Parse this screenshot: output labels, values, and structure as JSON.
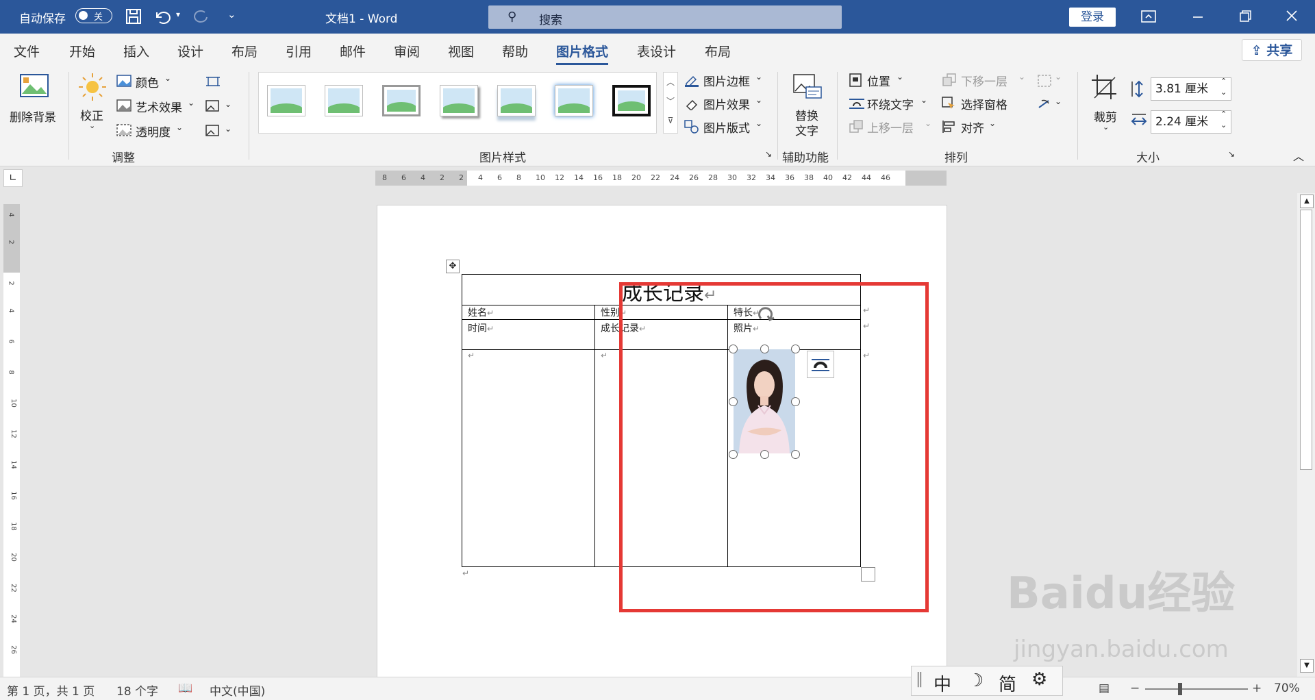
{
  "titlebar": {
    "autosave": "自动保存",
    "autosave_state": "关",
    "doc_title": "文档1  -  Word",
    "search_placeholder": "搜索",
    "login": "登录"
  },
  "tabs": [
    "文件",
    "开始",
    "插入",
    "设计",
    "布局",
    "引用",
    "邮件",
    "审阅",
    "视图",
    "帮助",
    "图片格式",
    "表设计",
    "布局"
  ],
  "active_tab": "图片格式",
  "share": "共享",
  "ribbon": {
    "remove_bg": "删除背景",
    "correct": "校正",
    "color": "颜色",
    "art_effects": "艺术效果",
    "transparency": "透明度",
    "group_adjust": "调整",
    "group_styles": "图片样式",
    "border": "图片边框",
    "effects": "图片效果",
    "layout": "图片版式",
    "alt_text": "替换\n文字",
    "alt_text_l1": "替换",
    "alt_text_l2": "文字",
    "group_access": "辅助功能",
    "position": "位置",
    "wrap_text": "环绕文字",
    "bring_forward": "上移一层",
    "send_backward": "下移一层",
    "select_pane": "选择窗格",
    "align": "对齐",
    "group_arrange": "排列",
    "crop": "裁剪",
    "height": "3.81 厘米",
    "width": "2.24 厘米",
    "group_size": "大小"
  },
  "ruler_numbers": [
    "8",
    "6",
    "4",
    "2",
    "2",
    "4",
    "6",
    "8",
    "10",
    "12",
    "14",
    "16",
    "18",
    "20",
    "22",
    "24",
    "26",
    "28",
    "30",
    "32",
    "34",
    "36",
    "38",
    "40",
    "42",
    "44",
    "46"
  ],
  "vruler_numbers": [
    "4",
    "2",
    "2",
    "4",
    "6",
    "8",
    "10",
    "12",
    "14",
    "16",
    "18",
    "20",
    "22",
    "24",
    "26"
  ],
  "table": {
    "title": "成长记录",
    "row1": [
      "姓名",
      "性别",
      "特长"
    ],
    "row2": [
      "时间",
      "成长记录",
      "照片"
    ]
  },
  "statusbar": {
    "page": "第 1 页，共 1 页",
    "words": "18 个字",
    "lang": "中文(中国)",
    "zoom": "70%"
  },
  "ime": [
    "中",
    "☽",
    "简",
    "⚙"
  ],
  "watermark": "Baidu经验",
  "watermark_url": "jingyan.baidu.com"
}
